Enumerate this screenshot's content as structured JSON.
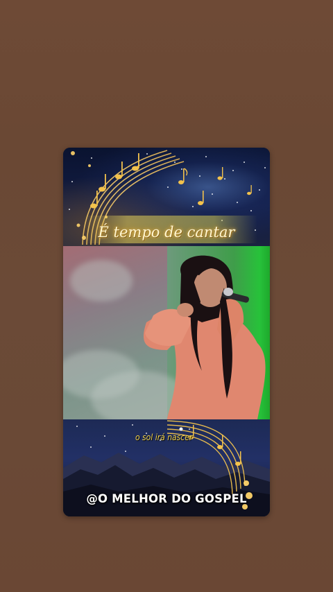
{
  "post": {
    "title": "É tempo de cantar",
    "subtitle": "o sol irá nascer",
    "handle": "@O MELHOR DO GOSPEL"
  },
  "colors": {
    "background": "#6b4a37",
    "title_glow": "#e8b84a",
    "subtitle": "#f1d24a",
    "handle": "#ffffff"
  },
  "icons": {
    "top_decoration": "music-notes-staff-icon",
    "bottom_decoration": "music-notes-staff-icon",
    "performer": "singer-with-microphone-image"
  }
}
